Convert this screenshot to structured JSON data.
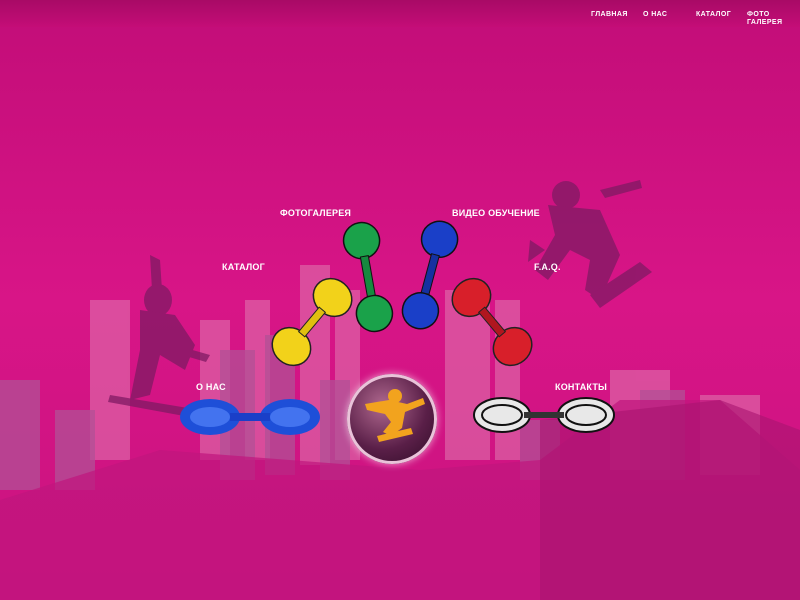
{
  "nav": {
    "items": [
      {
        "label": "ГЛАВНАЯ"
      },
      {
        "label": "О НАС"
      },
      {
        "label": "КАТАЛОГ"
      },
      {
        "label": "ФОТО ГАЛЕРЕЯ"
      }
    ]
  },
  "menu": {
    "o_nas": "О НАС",
    "katalog": "КАТАЛОГ",
    "fotogalereya": "ФОТОГАЛЕРЕЯ",
    "video": "ВИДЕО ОБУЧЕНИЕ",
    "faq": "F.A.Q.",
    "kontakty": "КОНТАКТЫ"
  },
  "colors": {
    "background": "#d0117f",
    "board_blue": "#1e4fd8",
    "board_yellow": "#f2d21a",
    "board_green": "#1aa24a",
    "board_navy": "#1a3fc8",
    "board_red": "#d81f2a",
    "board_white": "#e8e8e8",
    "sphere_figure": "#f2a31e"
  }
}
